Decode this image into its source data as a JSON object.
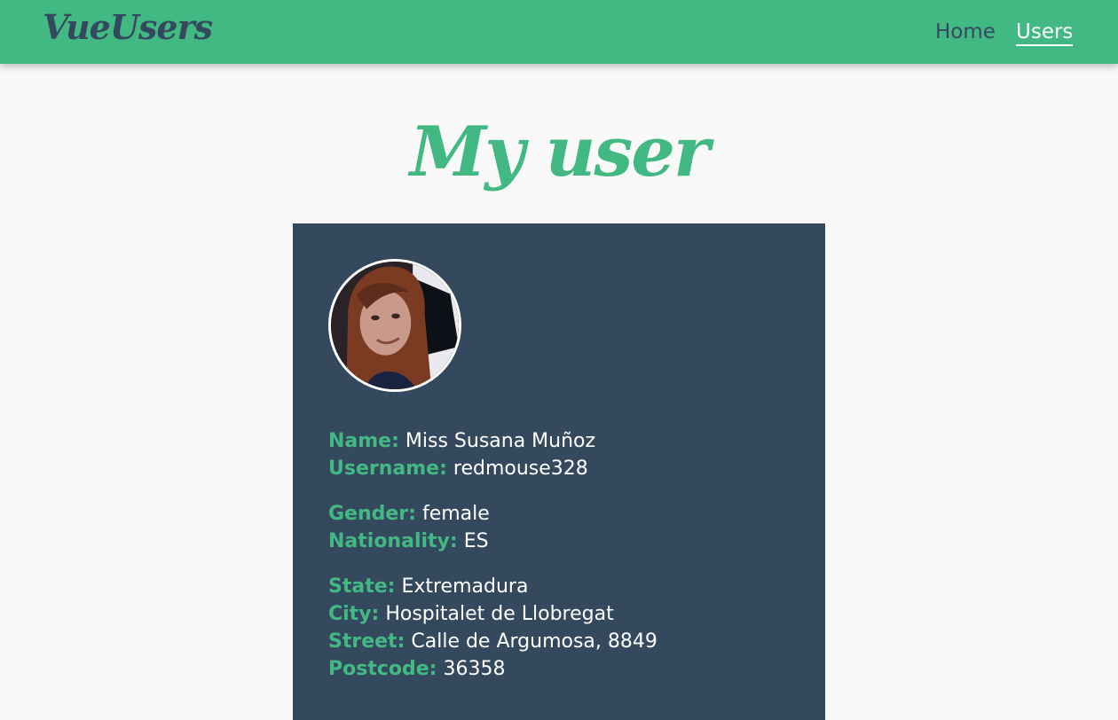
{
  "navbar": {
    "brand": "VueUsers",
    "links": [
      {
        "label": "Home",
        "active": false
      },
      {
        "label": "Users",
        "active": true
      }
    ]
  },
  "page": {
    "title": "My user"
  },
  "user": {
    "avatar_icon": "user-photo",
    "name": {
      "label": "Name:",
      "value": "Miss Susana Muñoz"
    },
    "username": {
      "label": "Username:",
      "value": "redmouse328"
    },
    "gender": {
      "label": "Gender:",
      "value": "female"
    },
    "nationality": {
      "label": "Nationality:",
      "value": "ES"
    },
    "state": {
      "label": "State:",
      "value": "Extremadura"
    },
    "city": {
      "label": "City:",
      "value": "Hospitalet de Llobregat"
    },
    "street": {
      "label": "Street:",
      "value": "Calle de Argumosa, 8849"
    },
    "postcode": {
      "label": "Postcode:",
      "value": "36358"
    }
  },
  "colors": {
    "accent": "#42b983",
    "dark": "#35495e",
    "background": "#f9f9f9",
    "text_light": "#ffffff"
  }
}
